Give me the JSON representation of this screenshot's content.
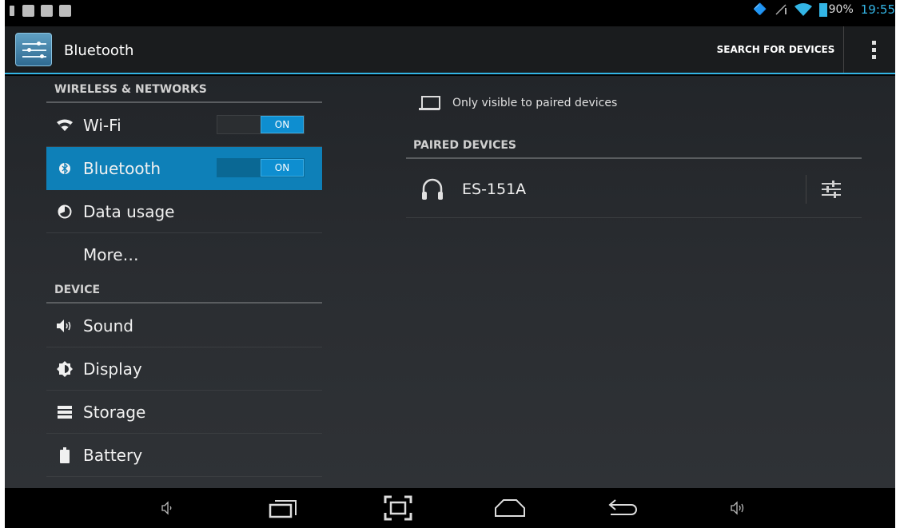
{
  "statusbar": {
    "battery_percent": "90%",
    "time": "19:55",
    "left_icons": [
      "usb-icon",
      "image-icon",
      "gmail-icon",
      "shopping-bag-icon"
    ],
    "right_icons": [
      "bluetooth-icon",
      "signal-off-icon",
      "wifi-icon",
      "battery-icon"
    ]
  },
  "actionbar": {
    "title": "Bluetooth",
    "search_label": "SEARCH FOR DEVICES",
    "accent": "#33b5e5"
  },
  "sidebar": {
    "sections": [
      {
        "header": "WIRELESS & NETWORKS",
        "items": [
          {
            "label": "Wi-Fi",
            "icon": "wifi-icon",
            "toggle": "ON"
          },
          {
            "label": "Bluetooth",
            "icon": "bluetooth-icon",
            "toggle": "ON",
            "active": true
          },
          {
            "label": "Data usage",
            "icon": "data-usage-icon"
          },
          {
            "label": "More…"
          }
        ]
      },
      {
        "header": "DEVICE",
        "items": [
          {
            "label": "Sound",
            "icon": "speaker-icon"
          },
          {
            "label": "Display",
            "icon": "brightness-icon"
          },
          {
            "label": "Storage",
            "icon": "storage-icon"
          },
          {
            "label": "Battery",
            "icon": "battery-icon"
          }
        ]
      }
    ],
    "active_color": "#0e80b8"
  },
  "detail": {
    "visibility_text": "Only visible to paired devices",
    "paired_header": "PAIRED DEVICES",
    "devices": [
      {
        "name": "ES-151A",
        "icon": "headphones-icon"
      }
    ]
  },
  "navbar": {
    "buttons": [
      "volume-down-icon",
      "recents-icon",
      "screenshot-icon",
      "home-icon",
      "back-icon",
      "volume-up-icon"
    ]
  }
}
